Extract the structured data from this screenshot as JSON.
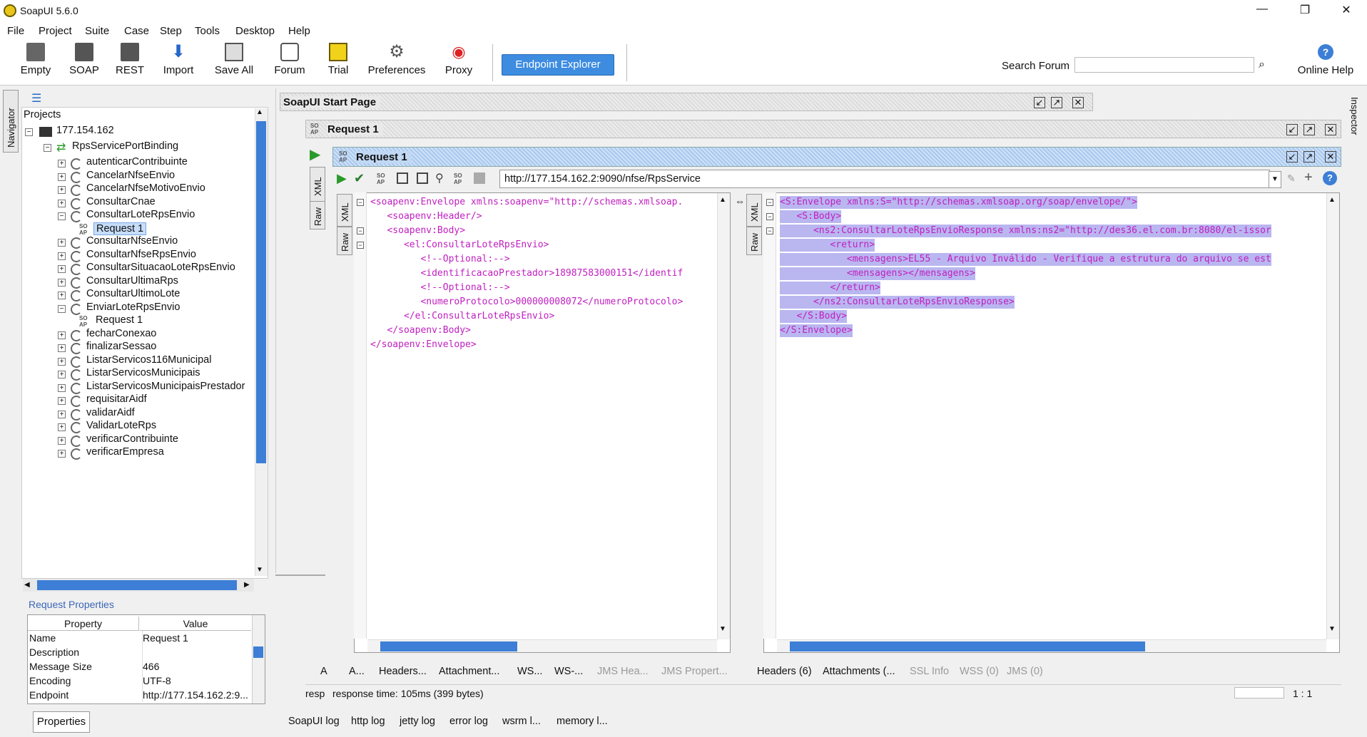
{
  "window": {
    "title": "SoapUI 5.6.0",
    "controls": {
      "minimize": "—",
      "maximize": "❐",
      "close": "✕"
    }
  },
  "menu": [
    "File",
    "Project",
    "Suite",
    "Case",
    "Step",
    "Tools",
    "Desktop",
    "Help"
  ],
  "toolbar": {
    "buttons": [
      "Empty",
      "SOAP",
      "REST",
      "Import",
      "Save All",
      "Forum",
      "Trial",
      "Preferences",
      "Proxy"
    ],
    "endpoint_explorer": "Endpoint Explorer",
    "search_label": "Search Forum",
    "search_value": "",
    "online_help": "Online Help"
  },
  "navigator": {
    "tab_label": "Navigator",
    "root_label": "Projects",
    "project": "177.154.162",
    "binding": "RpsServicePortBinding",
    "operations": [
      {
        "label": "autenticarContribuinte"
      },
      {
        "label": "CancelarNfseEnvio"
      },
      {
        "label": "CancelarNfseMotivoEnvio"
      },
      {
        "label": "ConsultarCnae"
      },
      {
        "label": "ConsultarLoteRpsEnvio",
        "expanded": true,
        "child": "Request 1",
        "child_selected": true
      },
      {
        "label": "ConsultarNfseEnvio"
      },
      {
        "label": "ConsultarNfseRpsEnvio"
      },
      {
        "label": "ConsultarSituacaoLoteRpsEnvio"
      },
      {
        "label": "ConsultarUltimaRps"
      },
      {
        "label": "ConsultarUltimoLote"
      },
      {
        "label": "EnviarLoteRpsEnvio",
        "expanded": true,
        "child": "Request 1"
      },
      {
        "label": "fecharConexao"
      },
      {
        "label": "finalizarSessao"
      },
      {
        "label": "ListarServicos116Municipal"
      },
      {
        "label": "ListarServicosMunicipais"
      },
      {
        "label": "ListarServicosMunicipaisPrestador"
      },
      {
        "label": "requisitarAidf"
      },
      {
        "label": "validarAidf"
      },
      {
        "label": "ValidarLoteRps"
      },
      {
        "label": "verificarContribuinte"
      },
      {
        "label": "verificarEmpresa"
      }
    ]
  },
  "properties": {
    "title": "Request Properties",
    "col_property": "Property",
    "col_value": "Value",
    "rows": [
      {
        "name": "Name",
        "value": "Request 1"
      },
      {
        "name": "Description",
        "value": ""
      },
      {
        "name": "Message Size",
        "value": "466"
      },
      {
        "name": "Encoding",
        "value": "UTF-8"
      },
      {
        "name": "Endpoint",
        "value": "http://177.154.162.2:9..."
      }
    ],
    "tab_label": "Properties"
  },
  "start_page": {
    "title": "SoapUI Start Page"
  },
  "request": {
    "outer_title": "Request 1",
    "inner_title": "Request 1",
    "url": "http://177.154.162.2:9090/nfse/RpsService",
    "tabs": {
      "xml": "XML",
      "raw": "Raw"
    },
    "request_xml": [
      "<soapenv:Envelope xmlns:soapenv=\"http://schemas.xmlsoap.",
      "   <soapenv:Header/>",
      "   <soapenv:Body>",
      "      <el:ConsultarLoteRpsEnvio>",
      "         <!--Optional:-->",
      "         <identificacaoPrestador>18987583000151</identif",
      "         <!--Optional:-->",
      "         <numeroProtocolo>000000008072</numeroProtocolo>",
      "      </el:ConsultarLoteRpsEnvio>",
      "   </soapenv:Body>",
      "</soapenv:Envelope>"
    ],
    "response_xml": [
      "<S:Envelope xmlns:S=\"http://schemas.xmlsoap.org/soap/envelope/\">",
      "   <S:Body>",
      "      <ns2:ConsultarLoteRpsEnvioResponse xmlns:ns2=\"http://des36.el.com.br:8080/el-issor",
      "         <return>",
      "            <mensagens>EL55 - Arquivo Inválido - Verifique a estrutura do arquivo se est",
      "            <mensagens></mensagens>",
      "         </return>",
      "      </ns2:ConsultarLoteRpsEnvioResponse>",
      "   </S:Body>",
      "</S:Envelope>"
    ],
    "request_tabs": [
      {
        "label": "A",
        "muted": false
      },
      {
        "label": "A...",
        "muted": false
      },
      {
        "label": "Headers...",
        "muted": false
      },
      {
        "label": "Attachment...",
        "muted": false
      },
      {
        "label": "WS...",
        "muted": false
      },
      {
        "label": "WS-...",
        "muted": false
      },
      {
        "label": "JMS Hea...",
        "muted": true
      },
      {
        "label": "JMS Propert...",
        "muted": true
      }
    ],
    "response_tabs": [
      {
        "label": "Headers (6)",
        "muted": false
      },
      {
        "label": "Attachments (...",
        "muted": false
      },
      {
        "label": "SSL Info",
        "muted": true
      },
      {
        "label": "WSS (0)",
        "muted": true
      },
      {
        "label": "JMS (0)",
        "muted": true
      }
    ],
    "status_left": "resp",
    "status": "response time: 105ms (399 bytes)",
    "cursor_pos": "1 : 1"
  },
  "logs": [
    "SoapUI log",
    "http log",
    "jetty log",
    "error log",
    "wsrm l...",
    "memory l..."
  ],
  "inspector": "Inspector",
  "colors": {
    "accent": "#3d8ce0",
    "selection": "#b9b6f0",
    "tag": "#c020c0"
  }
}
